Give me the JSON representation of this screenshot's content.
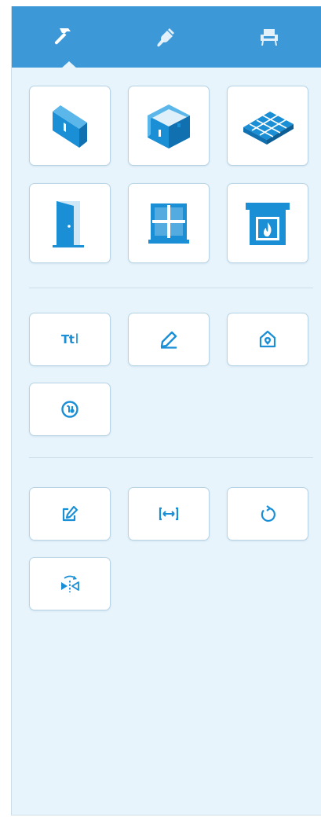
{
  "tabs": [
    {
      "id": "build",
      "icon": "hammer-icon",
      "active": true
    },
    {
      "id": "decorate",
      "icon": "paint-brush-icon",
      "active": false
    },
    {
      "id": "furnish",
      "icon": "armchair-icon",
      "active": false
    }
  ],
  "colors": {
    "accent": "#3d98d8",
    "icon": "#1a8fd6",
    "panel_bg": "#e8f4fb",
    "button_border": "#b7d4e6"
  },
  "build_tools": [
    {
      "id": "wall",
      "icon": "wall-icon"
    },
    {
      "id": "room",
      "icon": "room-icon"
    },
    {
      "id": "floor",
      "icon": "floor-tiles-icon"
    },
    {
      "id": "door",
      "icon": "door-icon"
    },
    {
      "id": "window",
      "icon": "window-icon"
    },
    {
      "id": "fireplace",
      "icon": "fireplace-icon"
    }
  ],
  "annotation_tools": [
    {
      "id": "text",
      "icon": "text-tool-icon",
      "label": "Tt"
    },
    {
      "id": "draw",
      "icon": "pencil-icon"
    },
    {
      "id": "location",
      "icon": "house-location-icon"
    },
    {
      "id": "badge",
      "icon": "circle-badge-icon"
    }
  ],
  "edit_tools": [
    {
      "id": "edit",
      "icon": "edit-icon"
    },
    {
      "id": "measure",
      "icon": "dimension-icon"
    },
    {
      "id": "rotate",
      "icon": "rotate-icon"
    },
    {
      "id": "mirror",
      "icon": "mirror-icon"
    }
  ]
}
